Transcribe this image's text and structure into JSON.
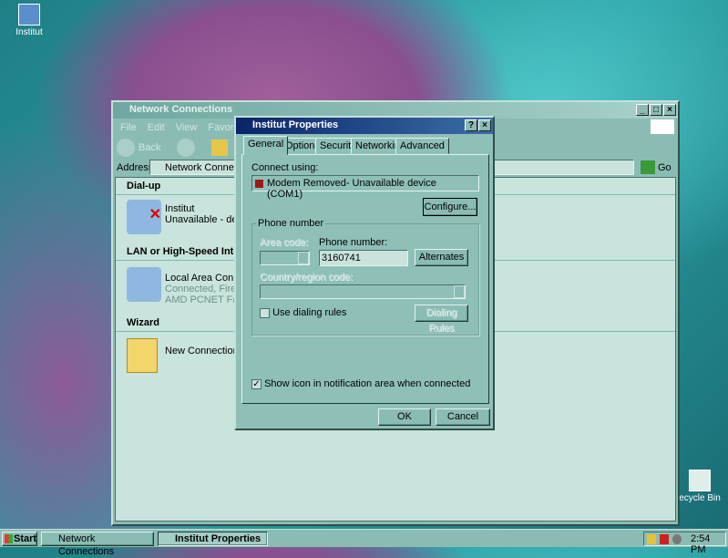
{
  "desktop": {
    "icons": [
      {
        "label": "Institut",
        "icon": "dialup-shortcut-icon"
      },
      {
        "label": "ecycle Bin",
        "icon": "recycle-bin-icon"
      }
    ]
  },
  "explorer": {
    "title": "Network Connections",
    "menu": [
      "File",
      "Edit",
      "View",
      "Favorites"
    ],
    "toolbar": {
      "back": "Back"
    },
    "address_label": "Address",
    "address_value": "Network Connections",
    "go": "Go",
    "sections": [
      {
        "title": "Dial-up",
        "items": [
          {
            "name": "Institut",
            "status": "Unavailable - device"
          }
        ]
      },
      {
        "title": "LAN or High-Speed Interne",
        "items": [
          {
            "name": "Local Area Connecti",
            "status": "Connected, Firewalle",
            "device": "AMD PCNET Family"
          }
        ]
      },
      {
        "title": "Wizard",
        "items": [
          {
            "name": "New Connection Wiz"
          }
        ]
      }
    ]
  },
  "dialog": {
    "title": "Institut Properties",
    "tabs": [
      "General",
      "Options",
      "Security",
      "Networking",
      "Advanced"
    ],
    "active_tab": "General",
    "connect_using_label": "Connect using:",
    "device": "Modem Removed- Unavailable device (COM1)",
    "configure": "Configure...",
    "phone_group": "Phone number",
    "area_code_label": "Area code:",
    "phone_label": "Phone number:",
    "phone_value": "3160741",
    "alternates": "Alternates",
    "country_label": "Country/region code:",
    "use_dialing_rules": "Use dialing rules",
    "use_dialing_rules_checked": false,
    "dialing_rules": "Dialing Rules",
    "show_icon": "Show icon in notification area when connected",
    "show_icon_checked": true,
    "ok": "OK",
    "cancel": "Cancel"
  },
  "taskbar": {
    "start": "Start",
    "tasks": [
      "Network Connections",
      "Institut Properties"
    ],
    "active_task": "Institut Properties",
    "clock": "2:54 PM"
  }
}
